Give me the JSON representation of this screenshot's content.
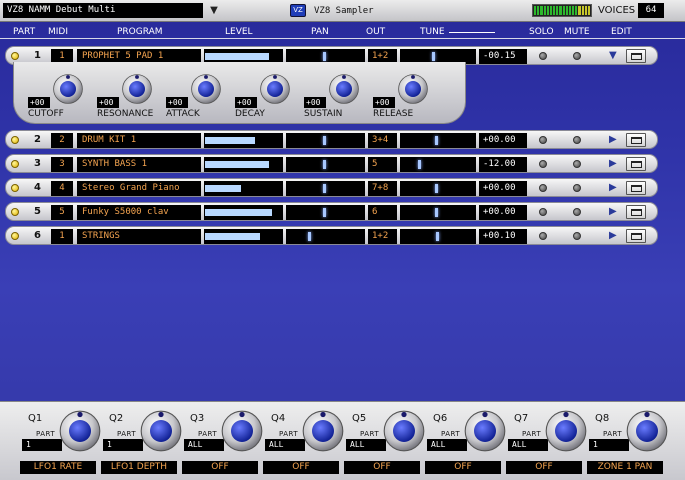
{
  "topbar": {
    "multi_name": "VZ8 NAMM Debut Multi",
    "dropdown": "▼",
    "app_icon": "VZ",
    "title": "VZ8 Sampler",
    "voices_label": "VOICES",
    "voices_value": "64"
  },
  "headers": {
    "part": "PART",
    "midi": "MIDI",
    "program": "PROGRAM",
    "level": "LEVEL",
    "pan": "PAN",
    "out": "OUT",
    "tune": "TUNE",
    "solo": "SOLO",
    "mute": "MUTE",
    "edit": "EDIT"
  },
  "parts": [
    {
      "part": "1",
      "midi": "1",
      "program": "PROPHET 5 PAD 1",
      "level": 0.84,
      "pan": 0.5,
      "out": "1+2",
      "tune_pos": 0.45,
      "tune": "-00.15",
      "edit_arrow": "▼"
    },
    {
      "part": "2",
      "midi": "2",
      "program": "DRUM KIT 1",
      "level": 0.66,
      "pan": 0.5,
      "out": "3+4",
      "tune_pos": 0.5,
      "tune": "+00.00",
      "edit_arrow": "▶"
    },
    {
      "part": "3",
      "midi": "3",
      "program": "SYNTH BASS 1",
      "level": 0.84,
      "pan": 0.5,
      "out": "5",
      "tune_pos": 0.25,
      "tune": "-12.00",
      "edit_arrow": "▶"
    },
    {
      "part": "4",
      "midi": "4",
      "program": "Stereo Grand Piano",
      "level": 0.47,
      "pan": 0.5,
      "out": "7+8",
      "tune_pos": 0.5,
      "tune": "+00.00",
      "edit_arrow": "▶"
    },
    {
      "part": "5",
      "midi": "5",
      "program": "Funky S5000 clav",
      "level": 0.88,
      "pan": 0.5,
      "out": "6",
      "tune_pos": 0.5,
      "tune": "+00.00",
      "edit_arrow": "▶"
    },
    {
      "part": "6",
      "midi": "1",
      "program": "STRINGS",
      "level": 0.72,
      "pan": 0.3,
      "out": "1+2",
      "tune_pos": 0.52,
      "tune": "+00.10",
      "edit_arrow": "▶"
    }
  ],
  "filter_panel": [
    {
      "label": "CUTOFF",
      "value": "+00"
    },
    {
      "label": "RESONANCE",
      "value": "+00"
    },
    {
      "label": "ATTACK",
      "value": "+00"
    },
    {
      "label": "DECAY",
      "value": "+00"
    },
    {
      "label": "SUSTAIN",
      "value": "+00"
    },
    {
      "label": "RELEASE",
      "value": "+00"
    }
  ],
  "quick_controls": [
    {
      "title": "Q1",
      "part_label": "PART",
      "part": "1",
      "assign": "LFO1 RATE"
    },
    {
      "title": "Q2",
      "part_label": "PART",
      "part": "1",
      "assign": "LFO1 DEPTH"
    },
    {
      "title": "Q3",
      "part_label": "PART",
      "part": "ALL",
      "assign": "OFF"
    },
    {
      "title": "Q4",
      "part_label": "PART",
      "part": "ALL",
      "assign": "OFF"
    },
    {
      "title": "Q5",
      "part_label": "PART",
      "part": "ALL",
      "assign": "OFF"
    },
    {
      "title": "Q6",
      "part_label": "PART",
      "part": "ALL",
      "assign": "OFF"
    },
    {
      "title": "Q7",
      "part_label": "PART",
      "part": "ALL",
      "assign": "OFF"
    },
    {
      "title": "Q8",
      "part_label": "PART",
      "part": "1",
      "assign": "ZONE 1 PAN"
    }
  ],
  "icons": {
    "led": "led-indicator",
    "solo": "solo-button",
    "mute": "mute-button",
    "edit": "folder-edit-icon"
  },
  "colors": {
    "background": "#2b2ea0",
    "text_orange": "#f4a450",
    "level_bar": "#b8d8ff",
    "led": "#e2b300"
  }
}
